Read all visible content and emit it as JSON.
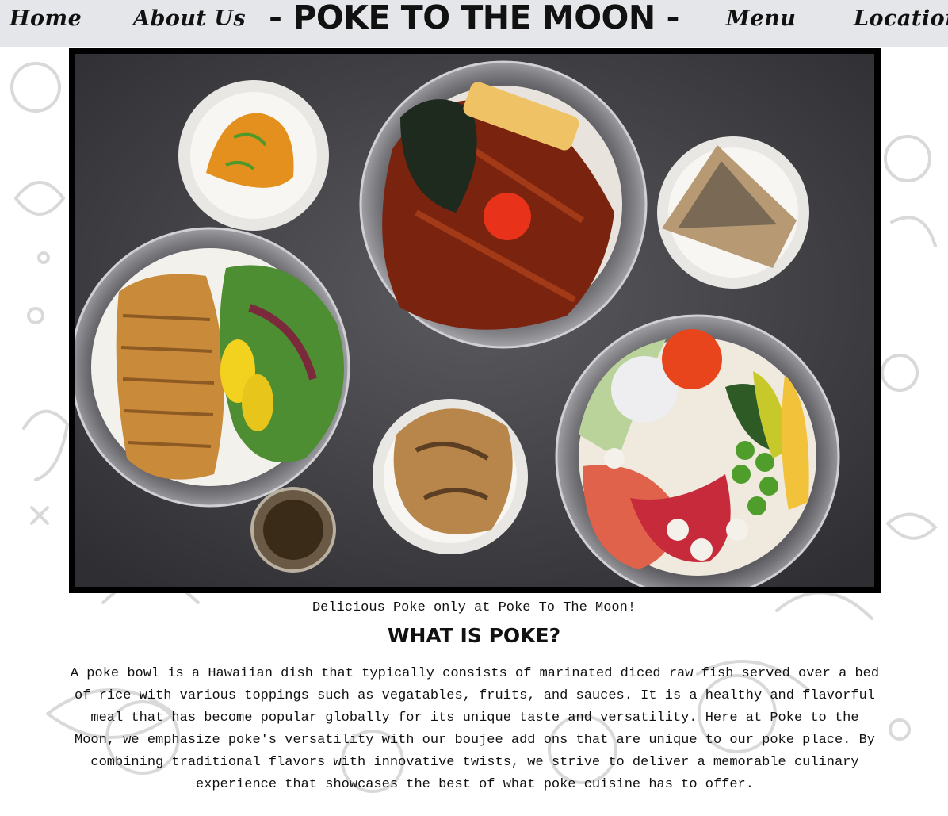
{
  "nav": {
    "home_label": "Home",
    "about_label": "About Us",
    "site_title": "- POKE TO THE MOON -",
    "menu_label": "Menu",
    "location_label": "Location"
  },
  "hero": {
    "alt": "Overhead photo of poke bowls, chicken rice bowl, unagi bowl and side dishes on a dark table"
  },
  "caption": "Delicious Poke only at Poke To The Moon!",
  "section": {
    "heading": "WHAT IS POKE?",
    "body": "A poke bowl is a Hawaiian dish that typically consists of marinated diced raw fish served over a bed of rice with various toppings such as vegatables, fruits, and sauces. It is a healthy and flavorful meal that has become popular globally for its unique taste and versatility. Here at Poke to the Moon, we emphasize poke's versatility with our boujee add ons that are unique to our poke place. By combining traditional flavors with innovative twists, we strive to deliver a memorable culinary experience that showcases the best of what poke cuisine has to offer."
  },
  "colors": {
    "nav_bg": "#e5e6ea",
    "text": "#111111",
    "photo_bg": "#4a4a4e"
  }
}
